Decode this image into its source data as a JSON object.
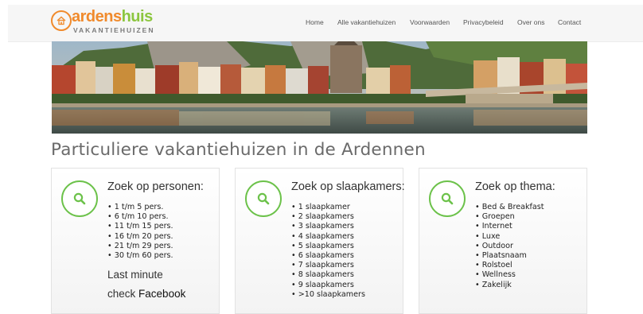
{
  "logo": {
    "name_part1": "ardens",
    "name_part2": "huis",
    "subtitle": "VAKANTIEHUIZEN"
  },
  "nav": {
    "items": [
      "Home",
      "Alle vakantiehuizen",
      "Voorwaarden",
      "Privacybeleid",
      "Over ons",
      "Contact"
    ]
  },
  "main": {
    "title": "Particuliere vakantiehuizen in de Ardennen"
  },
  "cards": [
    {
      "title": "Zoek op personen:",
      "items": [
        "1 t/m 5 pers.",
        "6 t/m 10 pers.",
        "11 t/m 15 pers.",
        "16 t/m 20 pers.",
        "21 t/m 29 pers.",
        "30 t/m 60 pers."
      ],
      "last_minute": "Last minute",
      "check_label": "check",
      "facebook": "Facebook"
    },
    {
      "title": "Zoek op slaapkamers:",
      "items": [
        "1 slaapkamer",
        "2 slaapkamers",
        "3 slaapkamers",
        "4 slaapkamers",
        "5 slaapkamers",
        "6 slaapkamers",
        "7 slaapkamers",
        "8 slaapkamers",
        "9 slaapkamers",
        ">10 slaapkamers"
      ]
    },
    {
      "title": "Zoek op thema:",
      "items": [
        "Bed & Breakfast",
        "Groepen",
        "Internet",
        "Luxe",
        "Outdoor",
        "Plaatsnaam",
        "Rolstoel",
        "Wellness",
        "Zakelijk"
      ]
    }
  ],
  "colors": {
    "accent_orange": "#f08a2c",
    "accent_green": "#6cc24a"
  }
}
